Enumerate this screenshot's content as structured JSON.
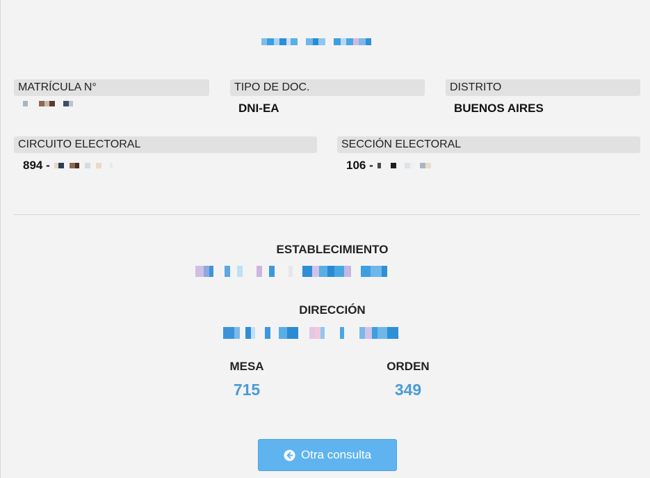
{
  "fields": {
    "matricula": {
      "label": "MATRÍCULA N°"
    },
    "tipo_doc": {
      "label": "TIPO DE DOC.",
      "value": "DNI-EA"
    },
    "distrito": {
      "label": "DISTRITO",
      "value": "BUENOS AIRES"
    },
    "circuito": {
      "label": "CIRCUITO ELECTORAL",
      "value_prefix": "894 -"
    },
    "seccion": {
      "label": "SECCIÓN ELECTORAL",
      "value_prefix": "106 -"
    }
  },
  "establecimiento": {
    "title": "ESTABLECIMIENTO"
  },
  "direccion": {
    "title": "DIRECCIÓN"
  },
  "mesa": {
    "title": "MESA",
    "value": "715"
  },
  "orden": {
    "title": "ORDEN",
    "value": "349"
  },
  "button": {
    "label": "Otra consulta",
    "icon": "arrow-left-circle-icon"
  },
  "colors": {
    "accent": "#4a9bd7",
    "button": "#5fb4f0",
    "label_bg": "#e1e1e1",
    "page_bg": "#f3f3f3"
  }
}
